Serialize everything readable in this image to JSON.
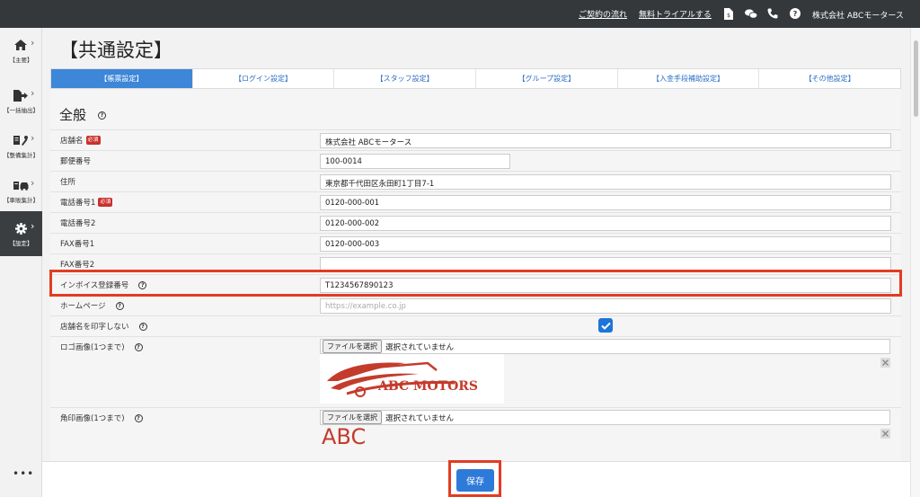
{
  "topbar": {
    "contract_flow_link": "ご契約の流れ",
    "free_trial_link": "無料トライアルする",
    "company_name": "株式会社 ABCモータース",
    "icons": [
      "document-icon",
      "chat-icon",
      "phone-icon",
      "help-icon"
    ]
  },
  "sidebar": {
    "items": [
      {
        "label": "【主要】",
        "icon": "home-icon"
      },
      {
        "label": "【一括抽出】",
        "icon": "file-export-icon"
      },
      {
        "label": "【整備集計】",
        "icon": "tools-icon"
      },
      {
        "label": "【車販集計】",
        "icon": "car-icon"
      },
      {
        "label": "【設定】",
        "icon": "gear-icon",
        "active": true
      }
    ],
    "more": "•••"
  },
  "page_title": "【共通設定】",
  "tabs": [
    {
      "label": "【帳票設定】",
      "active": true
    },
    {
      "label": "【ログイン設定】"
    },
    {
      "label": "【スタッフ設定】"
    },
    {
      "label": "【グループ設定】"
    },
    {
      "label": "【入金手段補助設定】"
    },
    {
      "label": "【その他設定】"
    }
  ],
  "section_title": "全般",
  "required_badge": "必須",
  "form": {
    "store_name": {
      "label": "店舗名",
      "value": "株式会社 ABCモータース"
    },
    "postal_code": {
      "label": "郵便番号",
      "value": "100-0014"
    },
    "address": {
      "label": "住所",
      "value": "東京都千代田区永田町1丁目7-1"
    },
    "phone1": {
      "label": "電話番号1",
      "value": "0120-000-001"
    },
    "phone2": {
      "label": "電話番号2",
      "value": "0120-000-002"
    },
    "fax1": {
      "label": "FAX番号1",
      "value": "0120-000-003"
    },
    "fax2": {
      "label": "FAX番号2",
      "value": ""
    },
    "invoice_number": {
      "label": "インボイス登録番号",
      "value": "T1234567890123"
    },
    "homepage": {
      "label": "ホームページ",
      "placeholder": "https://example.co.jp"
    },
    "hide_store_name": {
      "label": "店舗名を印字しない",
      "checked": true
    },
    "logo_image": {
      "label": "ロゴ画像(1つまで)",
      "button": "ファイルを選択",
      "status": "選択されていません",
      "preview_text": "ABC MOTORS"
    },
    "seal_image": {
      "label": "角印画像(1つまで)",
      "button": "ファイルを選択",
      "status": "選択されていません",
      "preview_text": "ABC モータ"
    }
  },
  "save_button": "保存",
  "colors": {
    "accent": "#2e7ad8",
    "highlight": "#e23c22",
    "required": "#c9302c",
    "topbar": "#34383b",
    "logo": "#c43b2c"
  }
}
